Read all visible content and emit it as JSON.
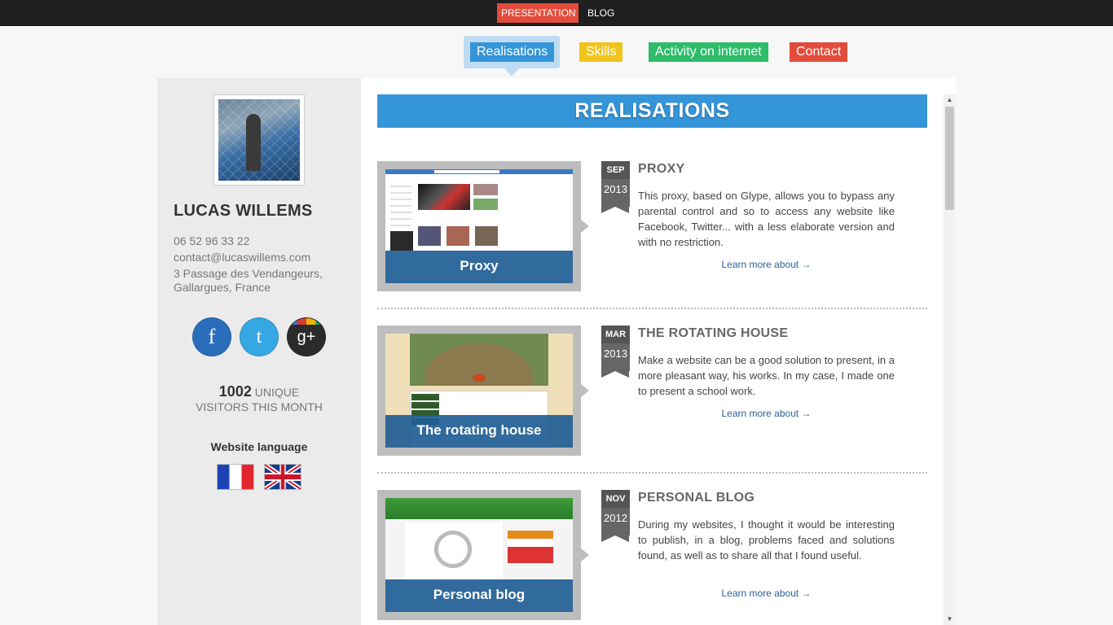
{
  "topbar": {
    "presentation_label": "PRESENTATION",
    "blog_label": "BLOG"
  },
  "tabs": {
    "realisations": "Realisations",
    "skills": "Skills",
    "activity": "Activity on internet",
    "contact": "Contact"
  },
  "profile": {
    "name": "LUCAS WILLEMS",
    "phone": "06 52 96 33 22",
    "email": "contact@lucaswillems.com",
    "address": "3 Passage des Vendangeurs, Gallargues, France"
  },
  "social": {
    "facebook_glyph": "f",
    "twitter_glyph": "t",
    "googleplus_glyph": "g+"
  },
  "stats": {
    "visitor_count": "1002",
    "visitor_unit": "UNIQUE",
    "visitor_caption": "VISITORS THIS MONTH"
  },
  "language": {
    "title": "Website language"
  },
  "main": {
    "banner_title": "REALISATIONS",
    "learn_more_label": "Learn more about →",
    "items": [
      {
        "thumb_caption": "Proxy",
        "month": "SEP",
        "year": "2013",
        "title": "PROXY",
        "description": "This proxy, based on Glype, allows you to bypass any parental control and so to access any website like Facebook, Twitter... with a less elaborate version and with no restriction."
      },
      {
        "thumb_caption": "The rotating house",
        "month": "MAR",
        "year": "2013",
        "title": "THE ROTATING HOUSE",
        "description": "Make a website can be a good solution to present, in a more pleasant way, his works. In my case, I made one to present a school work."
      },
      {
        "thumb_caption": "Personal blog",
        "month": "NOV",
        "year": "2012",
        "title": "PERSONAL BLOG",
        "description": "During my websites, I thought it would be interesting to publish, in a blog, problems faced and solutions found, as well as to share all that I found useful."
      }
    ]
  },
  "colors": {
    "blue": "#3595d9",
    "yellow": "#f0c31b",
    "green": "#2ebc6a",
    "red": "#e34c3b"
  }
}
